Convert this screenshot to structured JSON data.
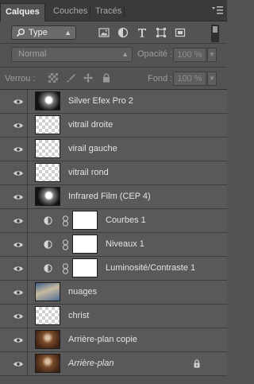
{
  "tabs": [
    {
      "label": "Calques",
      "active": true
    },
    {
      "label": "Couches",
      "active": false
    },
    {
      "label": "Tracés",
      "active": false
    }
  ],
  "panel_menu_icon": "panel-menu-icon",
  "filter": {
    "kind_label": "Type",
    "icons": [
      "pixel-filter-icon",
      "adjustment-filter-icon",
      "type-filter-icon",
      "shape-filter-icon",
      "smart-object-filter-icon"
    ]
  },
  "blend": {
    "mode": "Normal",
    "opacity_label": "Opacité :",
    "opacity_value": "100 %"
  },
  "lock": {
    "label": "Verrou :",
    "fill_label": "Fond :",
    "fill_value": "100 %",
    "icons": [
      "lock-transparency-icon",
      "lock-pixels-icon",
      "lock-position-icon",
      "lock-all-icon"
    ]
  },
  "layers": [
    {
      "name": "Silver Efex Pro 2",
      "kind": "image",
      "thumb": "bw-photo"
    },
    {
      "name": "vitrail droite",
      "kind": "image",
      "thumb": "transparent"
    },
    {
      "name": "virail gauche",
      "kind": "image",
      "thumb": "transparent"
    },
    {
      "name": "vitrail rond",
      "kind": "image",
      "thumb": "transparent"
    },
    {
      "name": "Infrared Film (CEP 4)",
      "kind": "image",
      "thumb": "bw-photo"
    },
    {
      "name": "Courbes 1",
      "kind": "adjustment"
    },
    {
      "name": "Niveaux 1",
      "kind": "adjustment"
    },
    {
      "name": "Luminosité/Contraste 1",
      "kind": "adjustment"
    },
    {
      "name": "nuages",
      "kind": "image",
      "thumb": "sky-photo"
    },
    {
      "name": "christ",
      "kind": "image",
      "thumb": "statue-cutout"
    },
    {
      "name": "Arrière-plan copie",
      "kind": "image",
      "thumb": "brown-photo"
    },
    {
      "name": "Arrière-plan",
      "kind": "background",
      "thumb": "brown-photo",
      "italic": true,
      "locked": true
    }
  ]
}
